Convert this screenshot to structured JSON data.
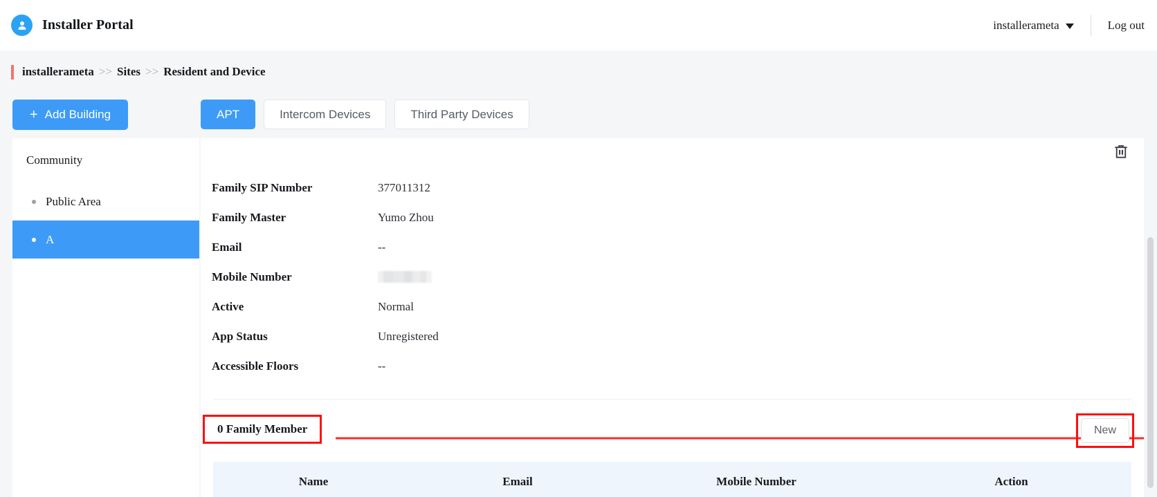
{
  "header": {
    "brand_title": "Installer Portal",
    "avatar_icon": "user-avatar-icon",
    "account_name": "installerameta",
    "caret_icon": "chevron-down-icon",
    "logout_label": "Log out"
  },
  "breadcrumb": {
    "separator": ">>",
    "items": [
      {
        "label": "installerameta"
      },
      {
        "label": "Sites"
      },
      {
        "label": "Resident and Device"
      }
    ]
  },
  "sidebar": {
    "add_building_label": "Add Building",
    "add_building_plus": "+",
    "heading": "Community",
    "items": [
      {
        "label": "Public Area",
        "active": false
      },
      {
        "label": "A",
        "active": true
      }
    ]
  },
  "tabs": [
    {
      "label": "APT",
      "active": true
    },
    {
      "label": "Intercom Devices",
      "active": false
    },
    {
      "label": "Third Party Devices",
      "active": false
    }
  ],
  "panel": {
    "delete_icon": "trash-icon",
    "fields": [
      {
        "label": "Family SIP Number",
        "value": "377011312",
        "redacted": false
      },
      {
        "label": "Family Master",
        "value": "Yumo Zhou",
        "redacted": false
      },
      {
        "label": "Email",
        "value": "--",
        "redacted": false
      },
      {
        "label": "Mobile Number",
        "value": "",
        "redacted": true
      },
      {
        "label": "Active",
        "value": "Normal",
        "redacted": false
      },
      {
        "label": "App Status",
        "value": "Unregistered",
        "redacted": false
      },
      {
        "label": "Accessible Floors",
        "value": "--",
        "redacted": false
      }
    ]
  },
  "family_section": {
    "title": "0 Family Member",
    "new_button_label": "New",
    "highlight_color": "#ff0d0d",
    "table": {
      "columns": [
        "Name",
        "Email",
        "Mobile Number",
        "Action"
      ],
      "rows": []
    }
  },
  "colors": {
    "accent_blue": "#3d9bf7",
    "page_background": "#f5f6f8",
    "table_header_background": "#eff5fd",
    "annotation_red": "#ff0d0d",
    "breadcrumb_tick": "#f2736c"
  }
}
